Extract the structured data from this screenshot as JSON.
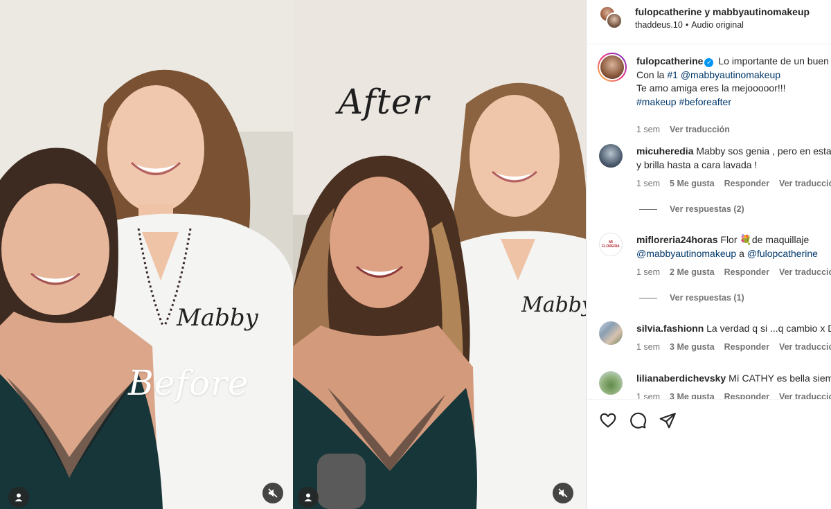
{
  "media": {
    "before_label": "Before",
    "after_label": "After",
    "shirt_script": "Mabby"
  },
  "header": {
    "authors": "fulopcatherine y mabbyautinomakeup",
    "audio_user": "thaddeus.10",
    "audio_separator": "•",
    "audio_label": "Audio original"
  },
  "caption": {
    "username": "fulopcatherine",
    "verified_mark": "✓",
    "line1": "Lo importante de un buen",
    "line2_prefix": "Con la ",
    "line2_tag": "#1",
    "line2_space": " ",
    "line2_mention": "@mabbyautinomakeup",
    "line3": "Te amo amiga eres la mejooooor!!!",
    "line4_tag1": "#makeup",
    "line4_space": " ",
    "line4_tag2": "#beforeafter",
    "time": "1 sem",
    "translate": "Ver traducción"
  },
  "comments": [
    {
      "username": "micuheredia",
      "text_line1": "Mabby sos genia , pero en esta",
      "text_line2": "y brilla hasta a cara lavada !",
      "time": "1 sem",
      "likes": "5 Me gusta",
      "reply": "Responder",
      "translate": "Ver traducción",
      "view_replies": "Ver respuestas (2)"
    },
    {
      "username": "mifloreria24horas",
      "text_prefix": "Flor ",
      "emoji": "💐",
      "text_suffix": "de maquillaje",
      "mention1": "@mabbyautinomakeup",
      "connector": " a ",
      "mention2": "@fulopcatherine",
      "avatar_text": "MI FLORERIA",
      "time": "1 sem",
      "likes": "2 Me gusta",
      "reply": "Responder",
      "translate": "Ver traducción",
      "view_replies": "Ver respuestas (1)"
    },
    {
      "username": "silvia.fashionn",
      "text": "La verdad q si ...q cambio x Dios",
      "time": "1 sem",
      "likes": "3 Me gusta",
      "reply": "Responder",
      "translate": "Ver traducción"
    },
    {
      "username": "lilianaberdichevsky",
      "text": "Mí CATHY es bella siempre",
      "time": "1 sem",
      "likes": "3 Me gusta",
      "reply": "Responder",
      "translate": "Ver traducción"
    }
  ],
  "icons": {
    "like": "heart-icon",
    "comment": "comment-icon",
    "share": "share-icon",
    "tag": "user-tag-icon",
    "mute": "mute-icon"
  },
  "colors": {
    "link": "#00376b",
    "verified": "#0095f6",
    "muted_text": "#737373"
  }
}
